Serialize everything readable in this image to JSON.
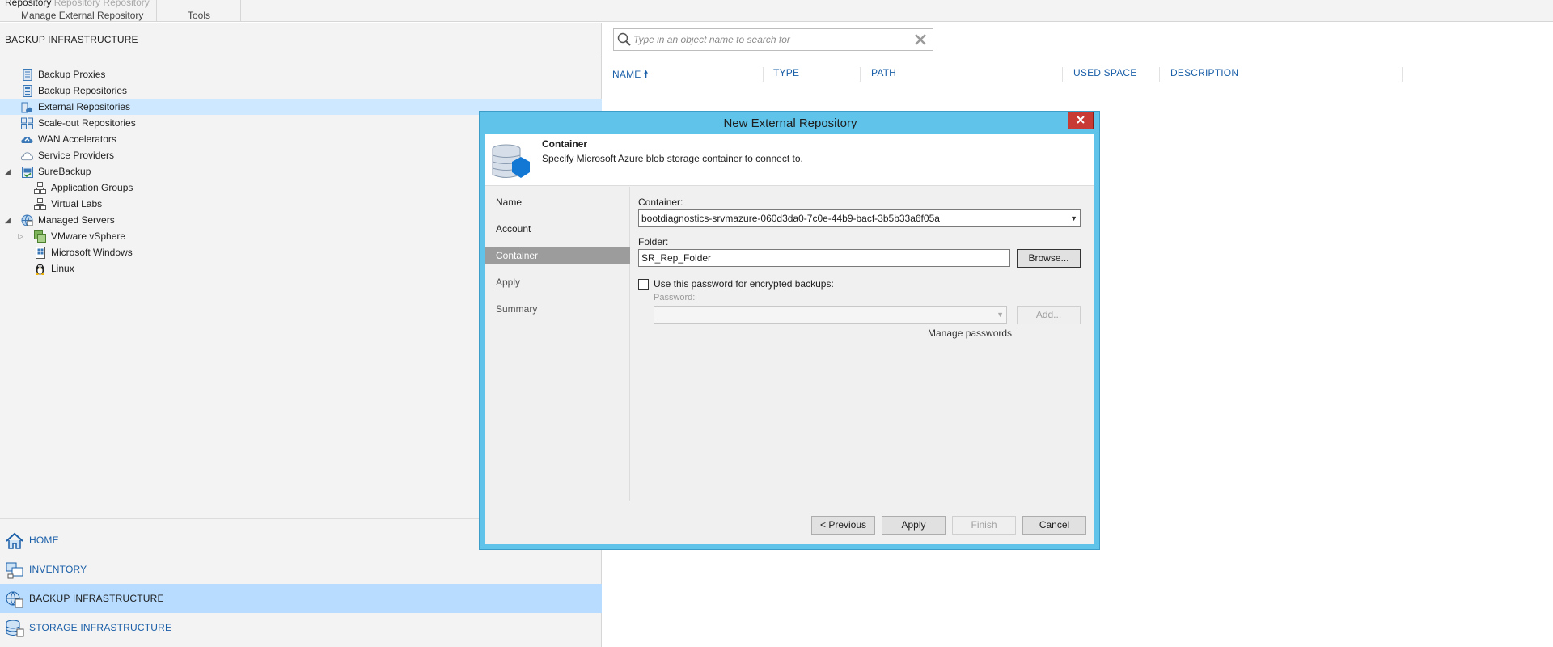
{
  "ribbon": {
    "row_labels": [
      "Repository",
      "Repository",
      "Repository"
    ],
    "group_manage": "Manage External Repository",
    "group_tools": "Tools"
  },
  "left_pane": {
    "title": "BACKUP INFRASTRUCTURE",
    "tree": [
      {
        "label": "Backup Proxies",
        "icon": "backup-proxy-icon"
      },
      {
        "label": "Backup Repositories",
        "icon": "backup-repository-icon"
      },
      {
        "label": "External Repositories",
        "icon": "cloud-repository-icon",
        "selected": true
      },
      {
        "label": "Scale-out Repositories",
        "icon": "scale-out-repository-icon"
      },
      {
        "label": "WAN Accelerators",
        "icon": "wan-accelerator-icon"
      },
      {
        "label": "Service Providers",
        "icon": "cloud-provider-icon"
      },
      {
        "label": "SureBackup",
        "icon": "surebackup-icon",
        "expanded": true
      },
      {
        "label": "Application Groups",
        "icon": "application-group-icon"
      },
      {
        "label": "Virtual Labs",
        "icon": "virtual-lab-icon"
      },
      {
        "label": "Managed Servers",
        "icon": "globe-server-icon",
        "expanded": true
      },
      {
        "label": "VMware vSphere",
        "icon": "vsphere-icon",
        "collapsed": true
      },
      {
        "label": "Microsoft Windows",
        "icon": "windows-server-icon"
      },
      {
        "label": "Linux",
        "icon": "linux-penguin-icon"
      }
    ],
    "nav": [
      {
        "label": "HOME",
        "icon": "home-icon"
      },
      {
        "label": "INVENTORY",
        "icon": "inventory-icon"
      },
      {
        "label": "BACKUP INFRASTRUCTURE",
        "icon": "backup-infrastructure-icon",
        "selected": true
      },
      {
        "label": "STORAGE INFRASTRUCTURE",
        "icon": "storage-infrastructure-icon"
      }
    ]
  },
  "search": {
    "placeholder": "Type in an object name to search for",
    "value": ""
  },
  "columns": [
    "NAME",
    "TYPE",
    "PATH",
    "USED SPACE",
    "DESCRIPTION"
  ],
  "dialog": {
    "title": "New External Repository",
    "header_title": "Container",
    "header_subtitle": "Specify Microsoft Azure blob storage container to connect to.",
    "steps": [
      "Name",
      "Account",
      "Container",
      "Apply",
      "Summary"
    ],
    "current_step": "Container",
    "container_label": "Container:",
    "container_value": "bootdiagnostics-srvmazure-060d3da0-7c0e-44b9-bacf-3b5b33a6f05a",
    "folder_label": "Folder:",
    "folder_value": "SR_Rep_Folder",
    "browse_label": "Browse...",
    "password_checkbox_label": "Use this password for encrypted backups:",
    "password_checked": false,
    "password_label": "Password:",
    "password_value": "",
    "add_label": "Add...",
    "manage_passwords_label": "Manage passwords",
    "buttons": {
      "previous": "< Previous",
      "apply": "Apply",
      "finish": "Finish",
      "cancel": "Cancel"
    }
  },
  "colors": {
    "accent": "#1a5fa8",
    "selection": "#cde8ff",
    "dialog_frame": "#5fc3ea",
    "close_button": "#c83b34"
  }
}
